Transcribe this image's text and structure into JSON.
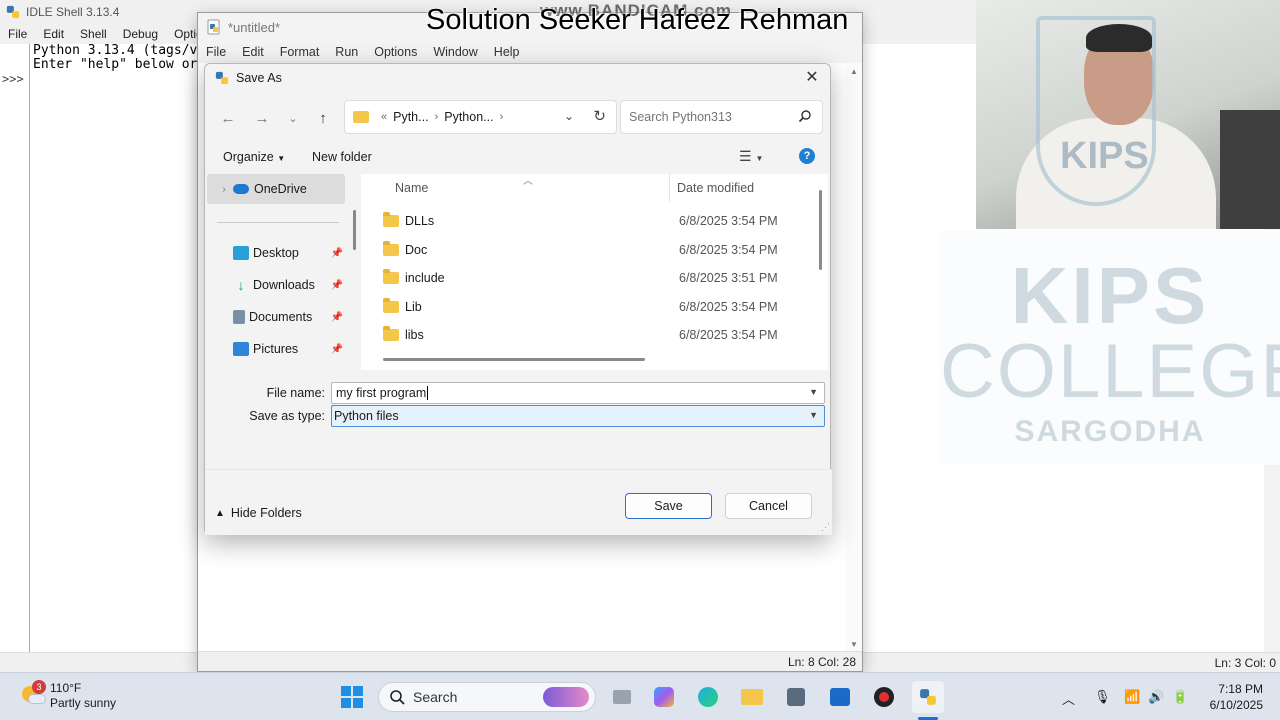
{
  "shell": {
    "title": "IDLE Shell 3.13.4",
    "menu": [
      "File",
      "Edit",
      "Shell",
      "Debug",
      "Optio"
    ],
    "lines": [
      "Python 3.13.4 (tags/v",
      "Enter \"help\" below or"
    ],
    "prompt": ">>>",
    "status": "Ln: 3   Col: 0"
  },
  "editor": {
    "title": "*untitled*",
    "menu": [
      "File",
      "Edit",
      "Format",
      "Run",
      "Options",
      "Window",
      "Help"
    ],
    "status": "Ln: 8   Col: 28"
  },
  "banner": {
    "text": "Solution Seeker Hafeez Rehman",
    "watermark": "www.BANDICAM.com"
  },
  "dialog": {
    "title": "Save As",
    "address": {
      "crumbs": [
        "Pyth...",
        "Python..."
      ],
      "prefix": "«"
    },
    "search_placeholder": "Search Python313",
    "toolbar": {
      "organize": "Organize",
      "new_folder": "New folder"
    },
    "nav": [
      {
        "label": "OneDrive",
        "icon": "onedrive-cloud-icon",
        "color": "#1e78d2"
      },
      {
        "label": "Desktop",
        "icon": "desktop-icon",
        "color": "#2aa0d8"
      },
      {
        "label": "Downloads",
        "icon": "download-arrow-icon",
        "color": "#23a05a"
      },
      {
        "label": "Documents",
        "icon": "documents-icon",
        "color": "#7a8ea8"
      },
      {
        "label": "Pictures",
        "icon": "pictures-icon",
        "color": "#2f86d6"
      }
    ],
    "columns": {
      "name": "Name",
      "date": "Date modified"
    },
    "files": [
      {
        "name": "DLLs",
        "date": "6/8/2025 3:54 PM"
      },
      {
        "name": "Doc",
        "date": "6/8/2025 3:54 PM"
      },
      {
        "name": "include",
        "date": "6/8/2025 3:51 PM"
      },
      {
        "name": "Lib",
        "date": "6/8/2025 3:54 PM"
      },
      {
        "name": "libs",
        "date": "6/8/2025 3:54 PM"
      }
    ],
    "file_name_label": "File name:",
    "file_name_value": "my first program",
    "save_type_label": "Save as type:",
    "save_type_value": "Python files",
    "hide_folders": "Hide Folders",
    "save_button": "Save",
    "cancel_button": "Cancel"
  },
  "watermark_logo": {
    "line1": "KIPS",
    "line2": "COLLEGE",
    "line3": "SARGODHA",
    "cam_logo": "KIPS"
  },
  "taskbar": {
    "weather_badge": "3",
    "temperature": "110°F",
    "condition": "Partly sunny",
    "search_label": "Search",
    "time": "7:18 PM",
    "date": "6/10/2025"
  }
}
